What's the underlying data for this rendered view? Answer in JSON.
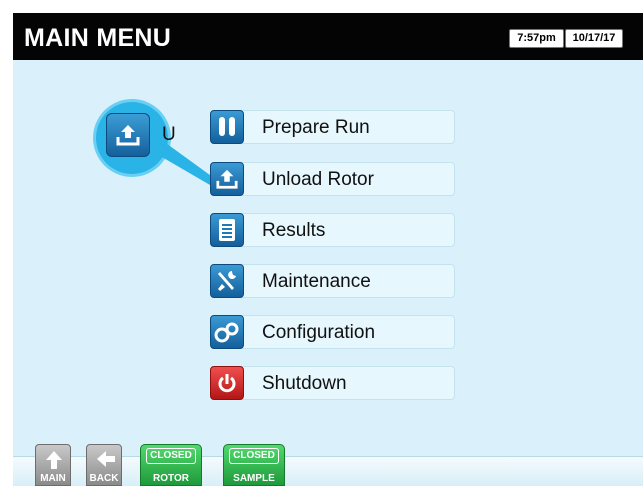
{
  "header": {
    "title": "MAIN MENU",
    "time": "7:57pm",
    "date": "10/17/17"
  },
  "menu": {
    "items": [
      {
        "label": "Prepare Run",
        "icon": "test-tubes-icon"
      },
      {
        "label": "Unload Rotor",
        "icon": "unload-icon"
      },
      {
        "label": "Results",
        "icon": "document-icon"
      },
      {
        "label": "Maintenance",
        "icon": "tools-icon"
      },
      {
        "label": "Configuration",
        "icon": "gears-icon"
      },
      {
        "label": "Shutdown",
        "icon": "power-icon"
      }
    ],
    "callout_fragment": "U"
  },
  "footer": {
    "main_label": "MAIN",
    "back_label": "BACK",
    "rotor_status": "CLOSED",
    "rotor_label": "ROTOR",
    "sample_status": "CLOSED",
    "sample_label": "SAMPLE"
  },
  "colors": {
    "accent": "#29b3e7",
    "menu_icon": "#1f78b8",
    "shutdown": "#d92a2a",
    "status_green": "#33b24f",
    "background": "#daf1fb"
  }
}
